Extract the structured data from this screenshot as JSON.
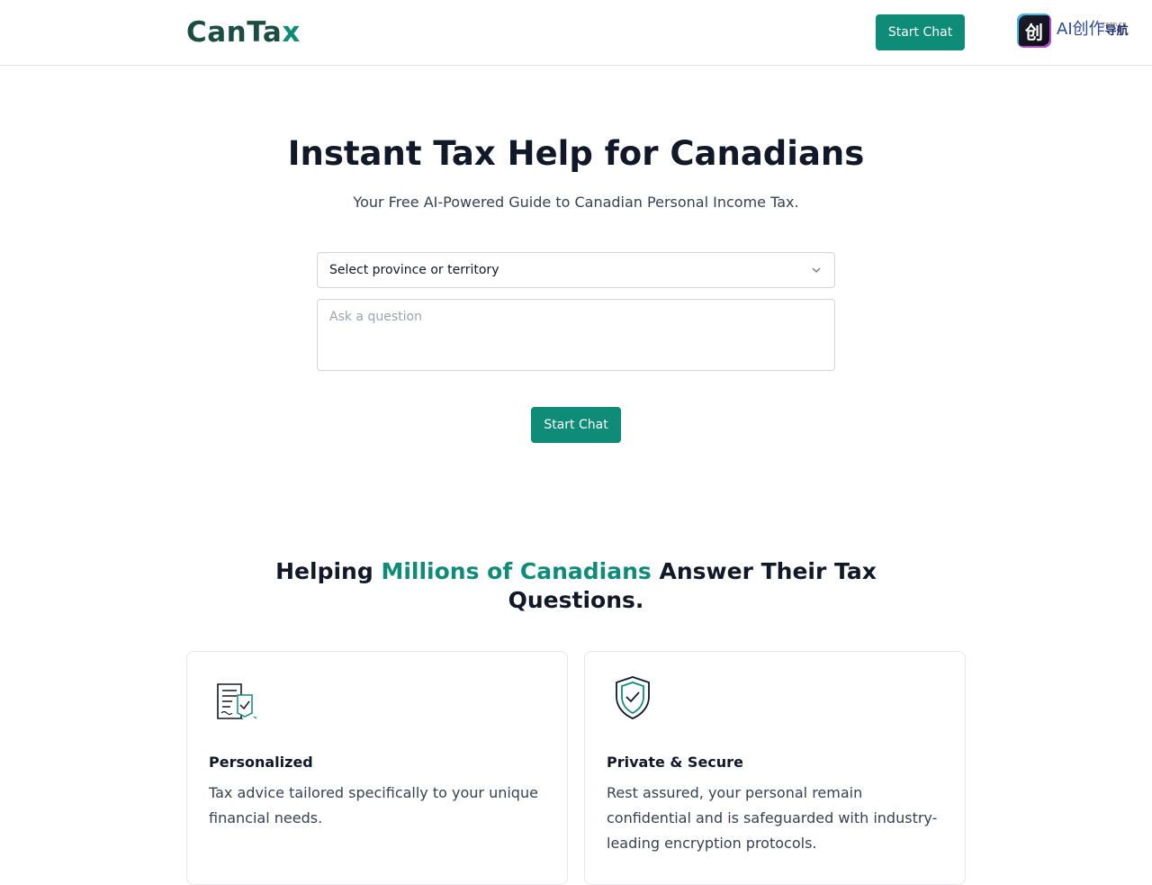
{
  "header": {
    "logo_main": "CanTa",
    "logo_x": "x",
    "start_chat_label": "Start Chat",
    "promo": {
      "icon_glyph": "创",
      "text": "AI创作",
      "nav": "导航",
      "sub": "cxgn.cn"
    }
  },
  "hero": {
    "title": "Instant Tax Help for Canadians",
    "subtitle": "Your Free AI-Powered Guide to Canadian Personal Income Tax.",
    "province_select": {
      "selected": "Select province or territory"
    },
    "question_input": {
      "placeholder": "Ask a question",
      "value": ""
    },
    "start_chat_label": "Start Chat"
  },
  "section": {
    "title_before": "Helping ",
    "title_highlight": "Millions of Canadians",
    "title_after": " Answer Their Tax Questions."
  },
  "features": [
    {
      "icon": "document-check-icon",
      "title": "Personalized",
      "text": "Tax advice tailored specifically to your unique financial needs."
    },
    {
      "icon": "shield-check-icon",
      "title": "Private & Secure",
      "text": "Rest assured, your personal remain confidential and is safeguarded with industry-leading encryption protocols."
    }
  ],
  "colors": {
    "accent": "#0e8c78",
    "brand_dark": "#1b4d43",
    "text": "#111827"
  }
}
